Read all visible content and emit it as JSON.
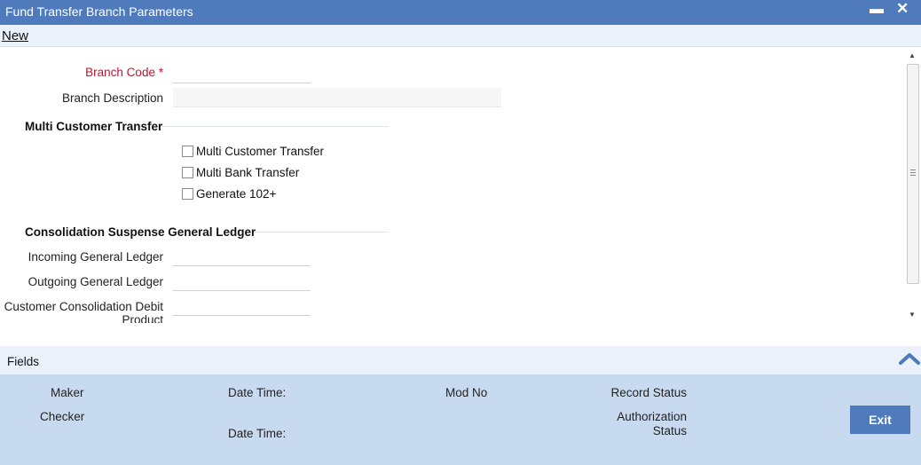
{
  "window": {
    "title": "Fund Transfer Branch Parameters",
    "minimize": "▬",
    "close": "✕"
  },
  "menu": {
    "new_label": "New"
  },
  "form": {
    "branch_code_label": "Branch Code",
    "required_marker": "*",
    "branch_code_value": "",
    "branch_description_label": "Branch Description",
    "branch_description_value": "",
    "multi_customer_section": "Multi Customer Transfer",
    "checkboxes": [
      {
        "label": "Multi Customer Transfer",
        "checked": false
      },
      {
        "label": "Multi Bank Transfer",
        "checked": false
      },
      {
        "label": "Generate 102+",
        "checked": false
      }
    ],
    "consolidation_section": "Consolidation Suspense General Ledger",
    "incoming_gl_label": "Incoming General Ledger",
    "incoming_gl_value": "",
    "outgoing_gl_label": "Outgoing General Ledger",
    "outgoing_gl_value": "",
    "customer_consolidation_label_line1": "Customer Consolidation Debit",
    "customer_consolidation_label_line2": "Product",
    "customer_consolidation_value": ""
  },
  "footer": {
    "fields_label": "Fields",
    "maker_label": "Maker",
    "checker_label": "Checker",
    "date_time_label": "Date Time:",
    "mod_no_label": "Mod No",
    "record_status_label": "Record Status",
    "authorization_label_line1": "Authorization",
    "authorization_label_line2": "Status",
    "exit_label": "Exit"
  },
  "colors": {
    "titlebar": "#4f7bbd",
    "required": "#c8102e",
    "audit_panel": "#c8daf0",
    "exit_button": "#4f7bbd"
  }
}
